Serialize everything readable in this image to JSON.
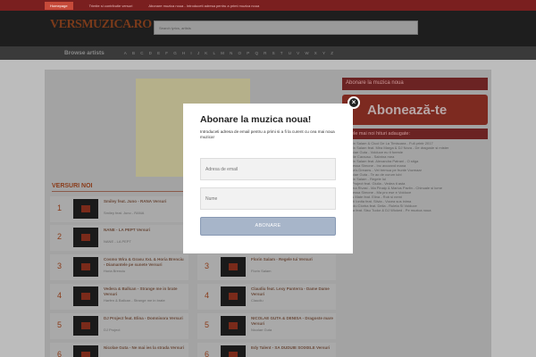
{
  "topnav": [
    "Homepage",
    "Trimite si contributie versuri",
    "Abonare muzica noua - Introduceti adresa pentru a primi muzica noua"
  ],
  "logo": "VERSMUZICA.RO",
  "search": {
    "placeholder": "Search lyrics, artists"
  },
  "browse": {
    "title": "Browse artists",
    "letters": [
      "A",
      "B",
      "C",
      "D",
      "E",
      "F",
      "G",
      "H",
      "I",
      "J",
      "K",
      "L",
      "M",
      "N",
      "O",
      "P",
      "Q",
      "R",
      "S",
      "T",
      "U",
      "V",
      "W",
      "X",
      "Y",
      "Z"
    ]
  },
  "sidebar": {
    "subscribe_title": "Abonare la muzica noua",
    "subscribe_button": "Abonează-te",
    "hits_title": "Cele mai noi hituri adaugate:",
    "hits": [
      "Florin Salam & Ciuci De La Timisoara - Fuli printr 2017",
      "Florin Salam feat. Mira Marga & DJ Nova - De dragoste si mister",
      "Nicolae Guta - Voiduce eu ti foreste",
      "Vitalie Carausu - Sabrina mea",
      "Florin Salam feat. Alexandra Patrani - O stiga",
      "Vanessa Simone - Inc avozand mana",
      "Carla's Dreams - Vei tremua pe frunte Vozmaar",
      "Nicolae Guta - Te ao de curum iubi",
      "Florin Salam - Regele Iui",
      "DJ Project feat. Giulia - Vedea ti asta",
      "Emma Rivasi - Ma Pinaip & Marius Pavlin - Chinuale si lume",
      "Vanessa Simone - Ma pro ese e Voiduce",
      "Miss Mate feat. Elina - Rob si nemi",
      "Costi Ionita feat. Silvia - Vocea sus inima",
      "Sandu Ciorba feat. Delia - Ruleta Si Voiduce",
      "Delia feat. Sisu Tudor & DJ Wicked - Pe muzica noua"
    ]
  },
  "versuri_label": "VERSURI NOI",
  "songs": [
    {
      "rank": "1",
      "title": "Smiley feat. Juno - RANA Versuri",
      "artist": "Smiley feat. Juno - RANA"
    },
    {
      "rank": "2",
      "title": "NANE - LA PEPT Versuri",
      "artist": "NANE - LA PEPT"
    },
    {
      "rank": "3",
      "title": "Cosmo Wira & Grasu XxL & Horia Brenciu - Diamantele pe sunete Versuri",
      "artist": "Horia Brenciu"
    },
    {
      "rank": "4",
      "title": "Vedera & Ballcan - Strange me in brate Versuri",
      "artist": "Harfen & Ballcan - Strange me in brate"
    },
    {
      "rank": "5",
      "title": "DJ Project feat. Elina - Domnisora Versuri",
      "artist": "DJ Project"
    },
    {
      "rank": "6",
      "title": "Nicolae Guta - Ne mai ies la strada Versuri",
      "artist": ""
    }
  ],
  "songs2": [
    {
      "rank": "3",
      "title": "Florin Salam - Regele Iui Versuri",
      "artist": "Florin Salam"
    },
    {
      "rank": "4",
      "title": "Claudiu feat. Lexy Panterra - Dame Dame Versuri",
      "artist": "Claudiu"
    },
    {
      "rank": "5",
      "title": "NICOLAE GUTA & DENISA - Dragoste mare Versuri",
      "artist": "Nicolae Guta"
    },
    {
      "rank": "6",
      "title": "Edy Talent - SA DUDUIE SOIXELE Versuri",
      "artist": ""
    }
  ],
  "modal": {
    "title": "Abonare la muzica noua!",
    "description": "Introduceti adresa de email pentru a primi si a fi la curent cu cea mai noua muzica!",
    "email_placeholder": "Adresa de email",
    "name_placeholder": "Nume",
    "button": "ABONARE",
    "close": "×"
  }
}
